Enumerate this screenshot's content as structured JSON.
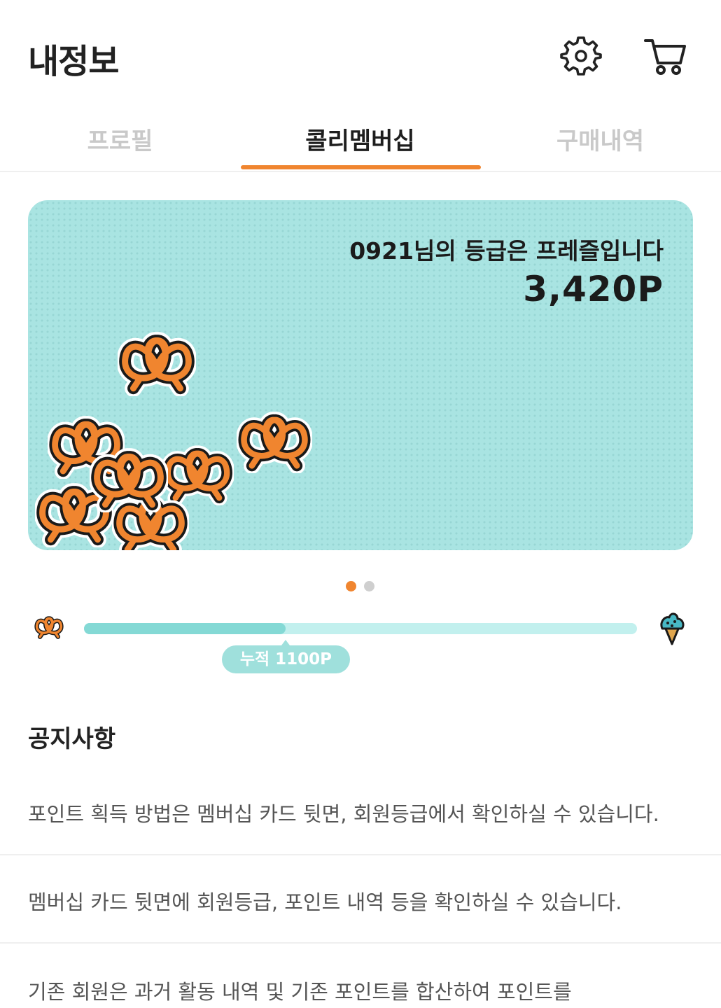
{
  "header": {
    "title": "내정보",
    "settings_icon": "gear-icon",
    "cart_icon": "cart-icon"
  },
  "tabs": [
    {
      "label": "프로필",
      "active": false
    },
    {
      "label": "콜리멤버십",
      "active": true
    },
    {
      "label": "구매내역",
      "active": false
    }
  ],
  "colors": {
    "accent": "#f0852f",
    "card_bg": "#a9e4e2",
    "progress_fill": "#84d9d5",
    "progress_track": "#c2f0ee"
  },
  "membership_card": {
    "greeting": "0921님의 등급은 프레즐입니다",
    "points": "3,420P",
    "illustration": "pretzel-stickers"
  },
  "carousel": {
    "current": 1,
    "total": 2
  },
  "progress": {
    "current_level_icon": "pretzel-icon",
    "next_level_icon": "ice-cream-icon",
    "fraction": 0.365,
    "label": "누적 1100P"
  },
  "notices": {
    "title": "공지사항",
    "items": [
      "포인트 획득 방법은 멤버십 카드 뒷면, 회원등급에서 확인하실 수 있습니다.",
      "멤버십 카드 뒷면에 회원등급, 포인트 내역 등을 확인하실 수 있습니다.",
      "기존 회원은 과거 활동 내역 및 기존 포인트를 합산하여 포인트를"
    ]
  }
}
